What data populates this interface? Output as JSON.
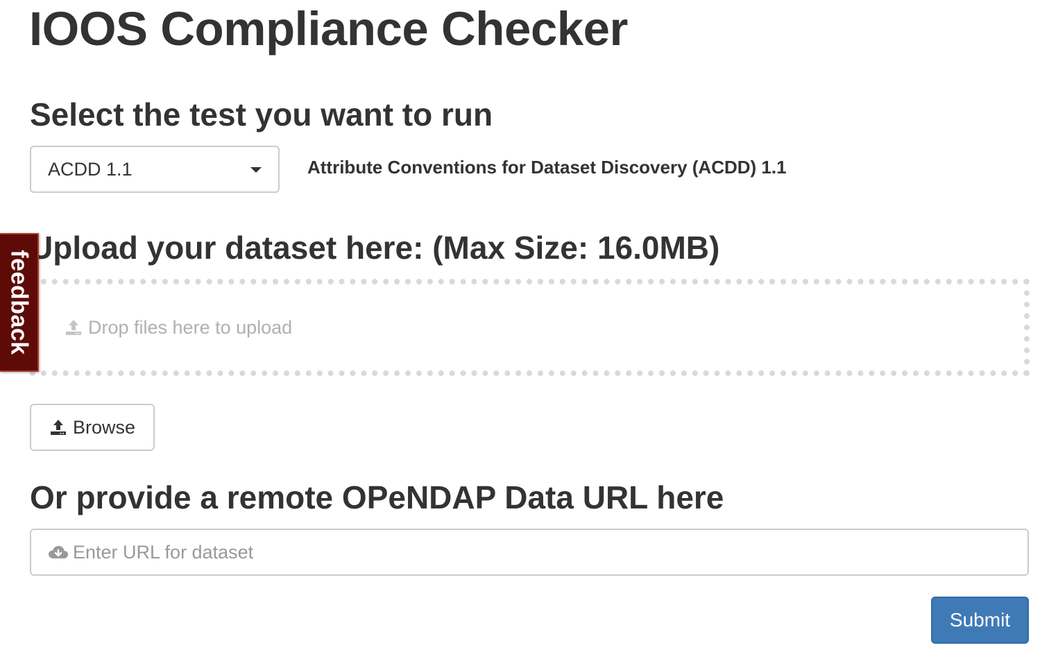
{
  "app": {
    "title": "IOOS Compliance Checker"
  },
  "test_section": {
    "heading": "Select the test you want to run",
    "selected_test": "ACDD 1.1",
    "description": "Attribute Conventions for Dataset Discovery (ACDD) 1.1"
  },
  "feedback": {
    "label": "feedback",
    "color": "#5e0b07"
  },
  "upload_section": {
    "heading": "Upload your dataset here: (Max Size: 16.0MB)",
    "dropzone_text": "Drop files here to upload",
    "dropzone_icon": "upload-icon",
    "browse_label": "Browse",
    "browse_icon": "upload-icon"
  },
  "url_section": {
    "heading": "Or provide a remote OPeNDAP Data URL here",
    "placeholder": "Enter URL for dataset",
    "input_icon": "cloud-download-icon"
  },
  "actions": {
    "submit_label": "Submit",
    "submit_color": "#3f7ab6"
  }
}
